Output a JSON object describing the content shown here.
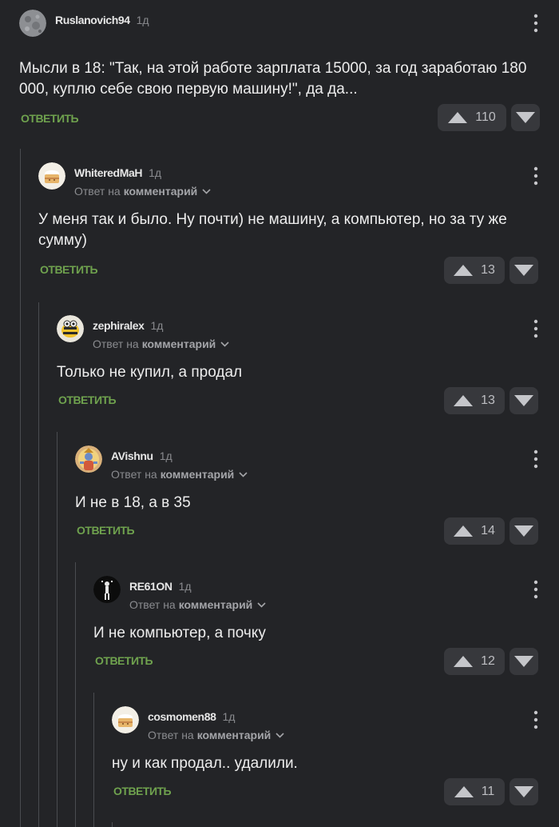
{
  "reply_label": "ОТВЕТИТЬ",
  "reply_prefix": "Ответ на",
  "reply_target": "комментарий",
  "comments": [
    {
      "username": "Ruslanovich94",
      "age": "1д",
      "avatar": "moon-avatar",
      "text": "Мысли в 18: \"Так, на этой работе зарплата 15000, за год заработаю 180 000, куплю себе свою первую машину!\", да да...",
      "votes": "110"
    },
    {
      "username": "WhiteredMaH",
      "age": "1д",
      "avatar": "cake-avatar",
      "text": "У меня так и было. Ну почти) не машину, а компьютер, но за ту же сумму)",
      "votes": "13"
    },
    {
      "username": "zephiralex",
      "age": "1д",
      "avatar": "bee-avatar",
      "text": "Только не купил, а продал",
      "votes": "13"
    },
    {
      "username": "AVishnu",
      "age": "1д",
      "avatar": "deity-avatar",
      "text": "И не в 18, а в 35",
      "votes": "14"
    },
    {
      "username": "RE61ON",
      "age": "1д",
      "avatar": "figure-avatar",
      "text": "И не компьютер, а почку",
      "votes": "12"
    },
    {
      "username": "cosmomen88",
      "age": "1д",
      "avatar": "cake-avatar",
      "text": "ну и как продал.. удалили.",
      "votes": "11"
    }
  ],
  "colors": {
    "background": "#232427",
    "reply_link": "#6fa24e",
    "vote_button": "#37383c",
    "thread_line": "#4a4c50"
  }
}
